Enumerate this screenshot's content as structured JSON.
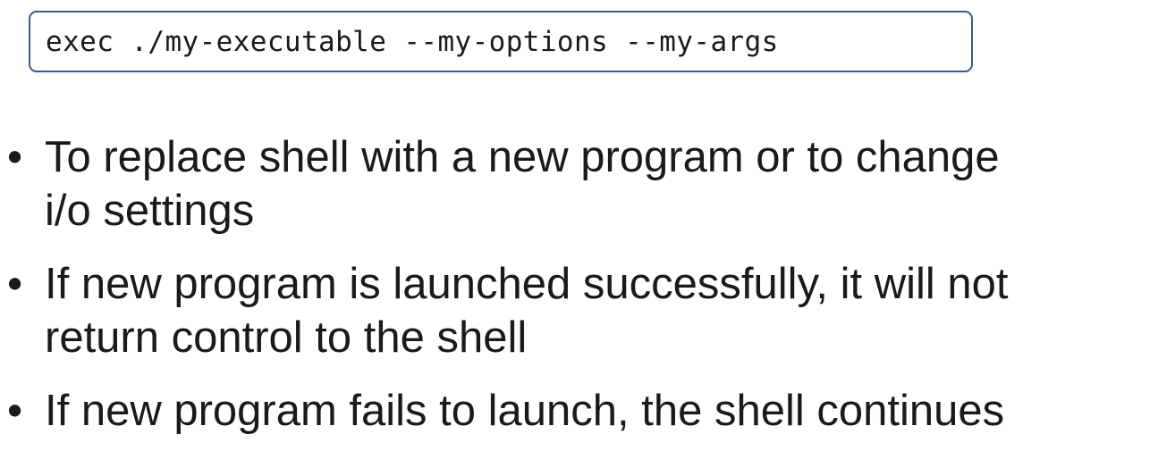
{
  "code_block": {
    "command": "exec ./my-executable --my-options --my-args"
  },
  "bullet_symbol": "•",
  "bullets": [
    {
      "lines": [
        "To replace shell with a new program or to change",
        "i/o settings"
      ]
    },
    {
      "lines": [
        "If new program is launched successfully, it will not",
        "return control to the shell"
      ]
    },
    {
      "lines": [
        "If new program fails to launch, the shell continues"
      ]
    }
  ]
}
